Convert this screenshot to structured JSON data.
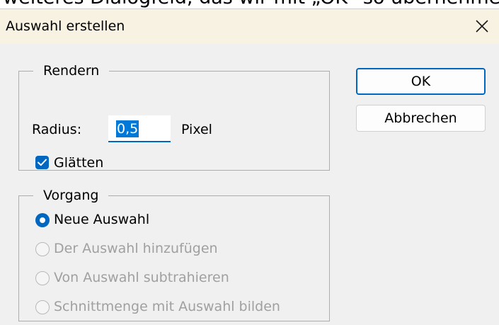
{
  "background_caption": "weiteres Dialogfeld, das wir mit „OK“ so übernehmen.",
  "dialog": {
    "title": "Auswahl erstellen",
    "close_icon": "close-icon"
  },
  "render_group": {
    "legend": "Rendern",
    "radius_label": "Radius:",
    "radius_value": "0,5",
    "radius_unit": "Pixel",
    "smooth_label": "Glätten",
    "smooth_checked": true
  },
  "operation_group": {
    "legend": "Vorgang",
    "options": [
      {
        "label": "Neue Auswahl",
        "selected": true,
        "enabled": true
      },
      {
        "label": "Der Auswahl hinzufügen",
        "selected": false,
        "enabled": false
      },
      {
        "label": "Von Auswahl subtrahieren",
        "selected": false,
        "enabled": false
      },
      {
        "label": "Schnittmenge mit Auswahl bilden",
        "selected": false,
        "enabled": false
      }
    ]
  },
  "buttons": {
    "ok": "OK",
    "cancel": "Abbrechen"
  },
  "colors": {
    "accent": "#0067c0",
    "title_bar": "#f8f2e2",
    "dialog_bg": "#f0f0f0",
    "disabled_text": "#a0a0a0"
  }
}
